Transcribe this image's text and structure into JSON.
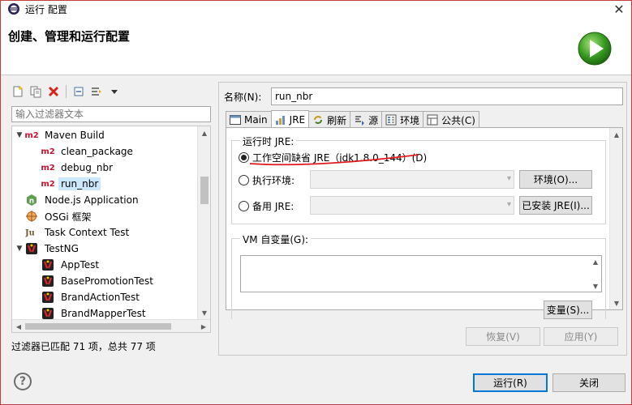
{
  "window": {
    "title": "运行 配置",
    "close_glyph": "✕"
  },
  "header": {
    "title": "创建、管理和运行配置",
    "logo_icon": "run-green-icon"
  },
  "toolbar": {
    "icons": [
      "new-config-icon",
      "duplicate-icon",
      "delete-icon",
      "collapse-all-icon",
      "filter-icon",
      "dropdown-icon"
    ]
  },
  "filter": {
    "placeholder": "输入过滤器文本",
    "status": "过滤器已匹配 71 项，总共 77 项"
  },
  "tree": {
    "items": [
      {
        "label": "Maven Build",
        "icon": "m2",
        "expanded": true
      },
      {
        "label": "clean_package",
        "icon": "m2"
      },
      {
        "label": "debug_nbr",
        "icon": "m2"
      },
      {
        "label": "run_nbr",
        "icon": "m2",
        "selected": true
      },
      {
        "label": "Node.js Application",
        "icon": "nodejs-icon"
      },
      {
        "label": "OSGi 框架",
        "icon": "osgi-icon"
      },
      {
        "label": "Task Context Test",
        "icon": "junit-icon"
      },
      {
        "label": "TestNG",
        "icon": "testng-icon",
        "expanded": true
      },
      {
        "label": "AppTest",
        "icon": "testng-icon"
      },
      {
        "label": "BasePromotionTest",
        "icon": "testng-icon"
      },
      {
        "label": "BrandActionTest",
        "icon": "testng-icon"
      },
      {
        "label": "BrandMapperTest",
        "icon": "testng-icon"
      }
    ],
    "m2_text": "m2",
    "node_text": "n",
    "junit_text": "Ju"
  },
  "config": {
    "name_label": "名称(N):",
    "name_value": "run_nbr",
    "tabs": [
      {
        "label": "Main",
        "icon": "main-tab-icon"
      },
      {
        "label": "JRE",
        "icon": "jre-tab-icon",
        "active": true
      },
      {
        "label": "刷新",
        "icon": "refresh-tab-icon"
      },
      {
        "label": "源",
        "icon": "source-tab-icon"
      },
      {
        "label": "环境",
        "icon": "environment-tab-icon"
      },
      {
        "label": "公共(C)",
        "icon": "common-tab-icon"
      }
    ],
    "runtime_jre": {
      "title": "运行时 JRE:",
      "workspace_default": "工作空间缺省 JRE（jdk1.8.0_144）(D)",
      "exec_env": "执行环境:",
      "env_button": "环境(O)...",
      "alternate": "备用 JRE:",
      "installed_button": "已安装 JRE(I)..."
    },
    "vm_args": {
      "title": "VM 自变量(G):",
      "variables_button": "变量(S)..."
    },
    "revert_button": "恢复(V)",
    "apply_button": "应用(Y)"
  },
  "footer": {
    "help_glyph": "?",
    "run_button": "运行(R)",
    "close_button": "关闭"
  },
  "colors": {
    "accent_focus": "#0078d7",
    "selection": "#cce8ff",
    "m2_red": "#c8102e",
    "run_green": "#3a9d23",
    "annotation_red": "#e0191b"
  }
}
